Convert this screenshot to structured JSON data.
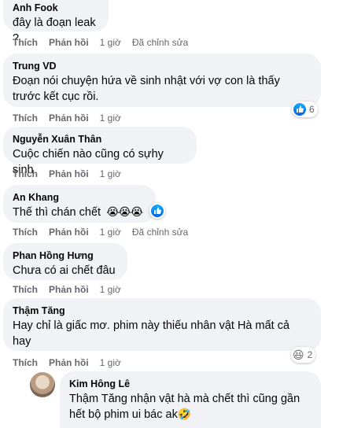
{
  "actions": {
    "like": "Thích",
    "reply": "Phản hồi"
  },
  "comments": [
    {
      "name": "Anh Fook",
      "text": "đây là đoạn leak ?",
      "time": "1 giờ",
      "edited": "Đã chỉnh sửa"
    },
    {
      "name": "Trung VD",
      "text": "Đoạn nói chuyện hứa về sinh nhật với vợ con là thấy trước kết cục rồi.",
      "time": "1 giờ",
      "reaction_count": "6",
      "reaction_icon": "like-icon"
    },
    {
      "name": "Nguyễn Xuân Thân",
      "text": "Cuộc chiến nào cũng có sựhy sinh",
      "time": "1 giờ"
    },
    {
      "name": "An Khang",
      "text": "Thế thì chán chết",
      "emojis": "😭😭😭",
      "time": "1 giờ",
      "edited": "Đã chỉnh sửa",
      "reaction_icon": "like-icon"
    },
    {
      "name": "Phan Hồng Hưng",
      "text": "Chưa có ai chết đâu",
      "time": "1 giờ"
    },
    {
      "name": "Thậm Tăng",
      "text": "Hay chỉ là giấc mơ. phim này thiếu nhân vật Hà mất cả hay",
      "time": "1 giờ",
      "reaction_count": "2",
      "reaction_icon": "haha-icon"
    },
    {
      "name": "Kim Hông Lê",
      "text": "Thậm Tăng nhận vật hà mà chết thì cũng gần hết bộ phim ui bác ak",
      "mention": "Thậm Tăng",
      "emoji_end": "🤣"
    }
  ]
}
